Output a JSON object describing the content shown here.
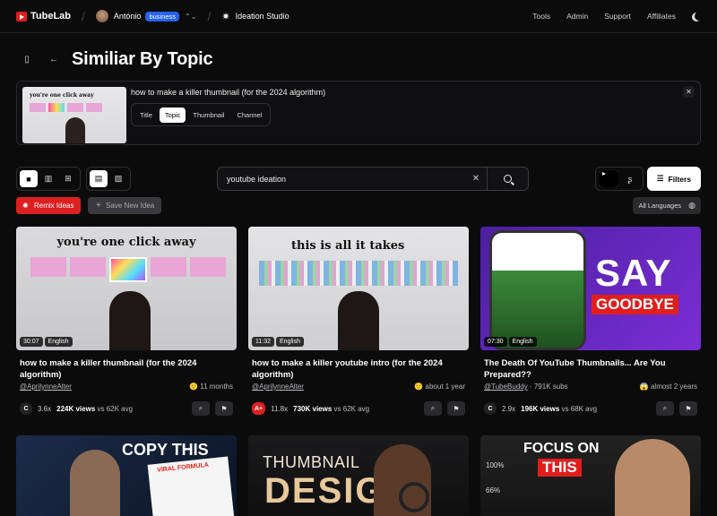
{
  "topbar": {
    "brand": "TubeLab",
    "user": "António",
    "plan_badge": "business",
    "studio": "Ideation Studio",
    "nav": [
      "Tools",
      "Admin",
      "Support",
      "Affiliates"
    ]
  },
  "page": {
    "title": "Similiar By Topic"
  },
  "reference": {
    "query": "how to make a killer thumbnail (for the 2024 algorithm)",
    "thumb_text": "you're one click away",
    "modes": [
      "Title",
      "Topic",
      "Thumbnail",
      "Channel"
    ],
    "active_mode": "Topic"
  },
  "search": {
    "value": "youtube ideation"
  },
  "buttons": {
    "filters": "Filters",
    "remix": "Remix Ideas",
    "save_idea": "Save New Idea",
    "languages": "All Languages"
  },
  "colors": {
    "accent": "#dc2020",
    "badge": "#2563eb"
  },
  "videos": [
    {
      "title": "how to make a killer thumbnail (for the 2024 algorithm)",
      "channel": "@AprilynneAlter",
      "age": "11 months",
      "duration": "30:07",
      "language": "English",
      "grade": "C",
      "multiplier": "3.6x",
      "views": "224K views",
      "avg": "vs 62K avg",
      "thumb_text": "you're one click away"
    },
    {
      "title": "how to make a killer youtube intro (for the 2024 algorithm)",
      "channel": "@AprilynneAlter",
      "age": "about 1 year",
      "duration": "11:32",
      "language": "English",
      "grade": "A+",
      "multiplier": "11.8x",
      "views": "730K views",
      "avg": "vs 62K avg",
      "thumb_text": "this is all it takes"
    },
    {
      "title": "The Death Of YouTube Thumbnails... Are You Prepared??",
      "channel": "@TubeBuddy",
      "subs": "791K subs",
      "age": "almost 2 years",
      "duration": "07:30",
      "language": "English",
      "grade": "C",
      "multiplier": "2.9x",
      "views": "196K views",
      "avg": "vs 68K avg",
      "thumb_text_1": "SAY",
      "thumb_text_2": "GOODBYE"
    }
  ],
  "row2": [
    {
      "thumb_text_1": "COPY THIS",
      "thumb_text_2": "VIRAL FORMULA"
    },
    {
      "thumb_text_1": "THUMBNAIL",
      "thumb_text_2": "DESIGN"
    },
    {
      "thumb_text_1": "FOCUS ON",
      "thumb_text_2": "THIS",
      "labels": [
        "100%",
        "66%"
      ]
    }
  ]
}
